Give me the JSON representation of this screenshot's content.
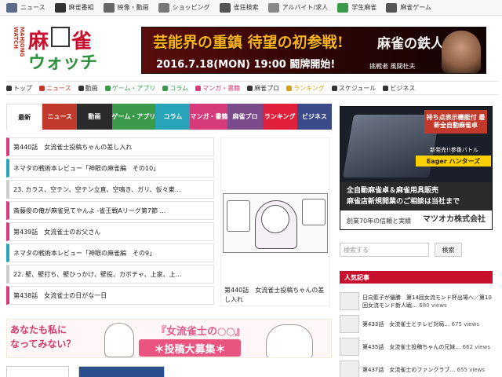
{
  "topbar": {
    "items": [
      {
        "label": "ニュース",
        "icon": "news-icon",
        "color": "#5b6b8a"
      },
      {
        "label": "麻雀番組",
        "icon": "film-icon",
        "color": "#333333"
      },
      {
        "label": "映像・動画",
        "icon": "video-icon",
        "color": "#666666"
      },
      {
        "label": "ショッピング",
        "icon": "cart-icon",
        "color": "#777777"
      },
      {
        "label": "雀荘検索",
        "icon": "search-icon",
        "color": "#555555"
      },
      {
        "label": "アルバイト/求人",
        "icon": "pencil-icon",
        "color": "#888888"
      },
      {
        "label": "学生麻雀",
        "icon": "triangle-icon",
        "color": "#3a9a4a"
      },
      {
        "label": "麻雀ゲーム",
        "icon": "gamepad-icon",
        "color": "#555555"
      }
    ]
  },
  "logo": {
    "side": "MAHJONG WATCH",
    "line1": "麻",
    "line1b": "雀",
    "line2": "ウォッチ"
  },
  "header_banner": {
    "headline": "芸能界の重鎮 待望の初参戦!",
    "date": "2016.7.18(MON) 19:00 闘牌開始!",
    "title_art": "麻雀の鉄人",
    "guest": "挑戦者 風間杜夫"
  },
  "nav": {
    "items": [
      {
        "label": "トップ",
        "color": "#333333"
      },
      {
        "label": "ニュース",
        "color": "#c0392b"
      },
      {
        "label": "動画",
        "color": "#333333"
      },
      {
        "label": "ゲーム・アプリ",
        "color": "#3a9a4a"
      },
      {
        "label": "コラム",
        "color": "#3a9a4a"
      },
      {
        "label": "マンガ・書籍",
        "color": "#d63a7a"
      },
      {
        "label": "麻雀プロ",
        "color": "#333333"
      },
      {
        "label": "ランキング",
        "color": "#d4a017"
      },
      {
        "label": "スケジュール",
        "color": "#333333"
      },
      {
        "label": "ビジネス",
        "color": "#333333"
      }
    ]
  },
  "tabs": [
    {
      "label": "最新",
      "color": "#ffffff"
    },
    {
      "label": "ニュース",
      "color": "#c0392b"
    },
    {
      "label": "動画",
      "color": "#2b2b2b"
    },
    {
      "label": "ゲーム・アプリ",
      "color": "#3a9a4a"
    },
    {
      "label": "コラム",
      "color": "#29a3b8"
    },
    {
      "label": "マンガ・書籍",
      "color": "#d63a7a"
    },
    {
      "label": "麻雀プロ",
      "color": "#7a4a8a"
    },
    {
      "label": "ランキング",
      "color": "#e0203a"
    },
    {
      "label": "ビジネス",
      "color": "#3a4a8a"
    }
  ],
  "articles": [
    {
      "title": "第440話　女流雀士投稿ちゃんの差し入れ",
      "color": "#d63a7a"
    },
    {
      "title": "ネマタの戦術本レビュー「神眼の麻雀編　その10」",
      "color": "#29a3b8"
    },
    {
      "title": "23. カラス、空テン、空テン立直、空鳴き、ガリ、仮々東…",
      "color": "#cccccc"
    },
    {
      "title": "斎藤俊の俺が麻雀見てやんよ -雀王戦Aリーグ第7節 …",
      "color": "#d63a7a"
    },
    {
      "title": "第439話　女流雀士のお父さん",
      "color": "#d63a7a"
    },
    {
      "title": "ネマタの戦術本レビュー「神眼の麻雀編　その9」",
      "color": "#29a3b8"
    },
    {
      "title": "22. 壁、壁打ち、壁ひっかけ、壁役、カボチャ、上家、上…",
      "color": "#cccccc"
    },
    {
      "title": "第438話　女流雀士の日がな一日",
      "color": "#d63a7a"
    }
  ],
  "feature": {
    "caption": "第440話　女流雀士投稿ちゃんの差し入れ"
  },
  "recruit_banner": {
    "lead_line1": "あなたも",
    "lead_line1b": "私に",
    "lead_line2": "なってみない？",
    "title": "『女流雀士の○○』",
    "cta": "＊投稿大募集＊"
  },
  "side_ad": {
    "badge": "持ち点表示機能付 最新全自動麻雀卓",
    "tagline": "新発売!!参番バトル",
    "product": "Eager ハンターズ",
    "body1": "全自動麻雀卓＆麻雀用具販売",
    "body2": "麻雀店新規開業のご相談は当社まで",
    "since": "創業70年の信頼と実績",
    "company": "マツオカ株式会社"
  },
  "search": {
    "placeholder": "検索する",
    "button": "検索"
  },
  "popular": {
    "heading": "人気記事",
    "items": [
      {
        "title": "日向藍子が優勝　第14回女流モンド杯出場へ／第10回女流モンド新人戦…",
        "views": "680 views"
      },
      {
        "title": "第433話　女流雀士とテレビ対局…",
        "views": "675 views"
      },
      {
        "title": "第435話　女流雀士投稿ちゃんの兄妹…",
        "views": "662 views"
      },
      {
        "title": "第437話　女流雀士のファンクラブ…",
        "views": "655 views"
      }
    ]
  },
  "colors": {
    "accent": "#c8102e",
    "brand_green": "#2d8f3a"
  }
}
